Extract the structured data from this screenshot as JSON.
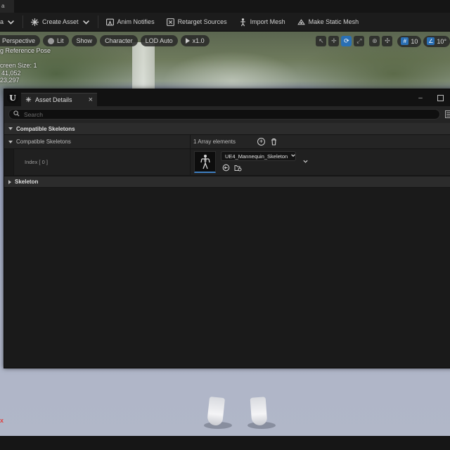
{
  "colors": {
    "accent_blue": "#2a6fb4",
    "panel_bg": "#1a1a1a",
    "row_bg": "#242424",
    "category_bg": "#2c2c2c",
    "axis_red": "#e04040"
  },
  "top_tab": {
    "label": "a"
  },
  "toolbar": {
    "items": [
      {
        "label": "a",
        "icon": "chevron-down-icon"
      },
      {
        "label": "Create Asset",
        "icon": "create-asset-icon"
      },
      {
        "label": "Anim Notifies",
        "icon": "anim-notifies-icon"
      },
      {
        "label": "Retarget Sources",
        "icon": "retarget-icon"
      },
      {
        "label": "Import Mesh",
        "icon": "import-mesh-icon"
      },
      {
        "label": "Make Static Mesh",
        "icon": "static-mesh-icon"
      }
    ]
  },
  "viewport": {
    "toolbar": {
      "perspective": "Perspective",
      "lit": "Lit",
      "show": "Show",
      "character": "Character",
      "lod": "LOD Auto",
      "play_rate": "x1.0",
      "grid_size": "10",
      "rotation_snap": "10°"
    },
    "stats": [
      "g Reference Pose",
      "",
      "creen Size: 1",
      "41,052",
      "23,297"
    ],
    "axis_label": "x"
  },
  "asset_details": {
    "tab_label": "Asset Details",
    "tab_close": "×",
    "search_placeholder": "Search",
    "window_min": "–",
    "categories": {
      "compatible": "Compatible Skeletons",
      "skeleton": "Skeleton"
    },
    "property": {
      "name": "Compatible Skeletons",
      "array_info": "1 Array elements"
    },
    "element": {
      "index_label": "Index [ 0 ]",
      "asset_name": "UE4_Mannequin_Skeleton"
    }
  }
}
